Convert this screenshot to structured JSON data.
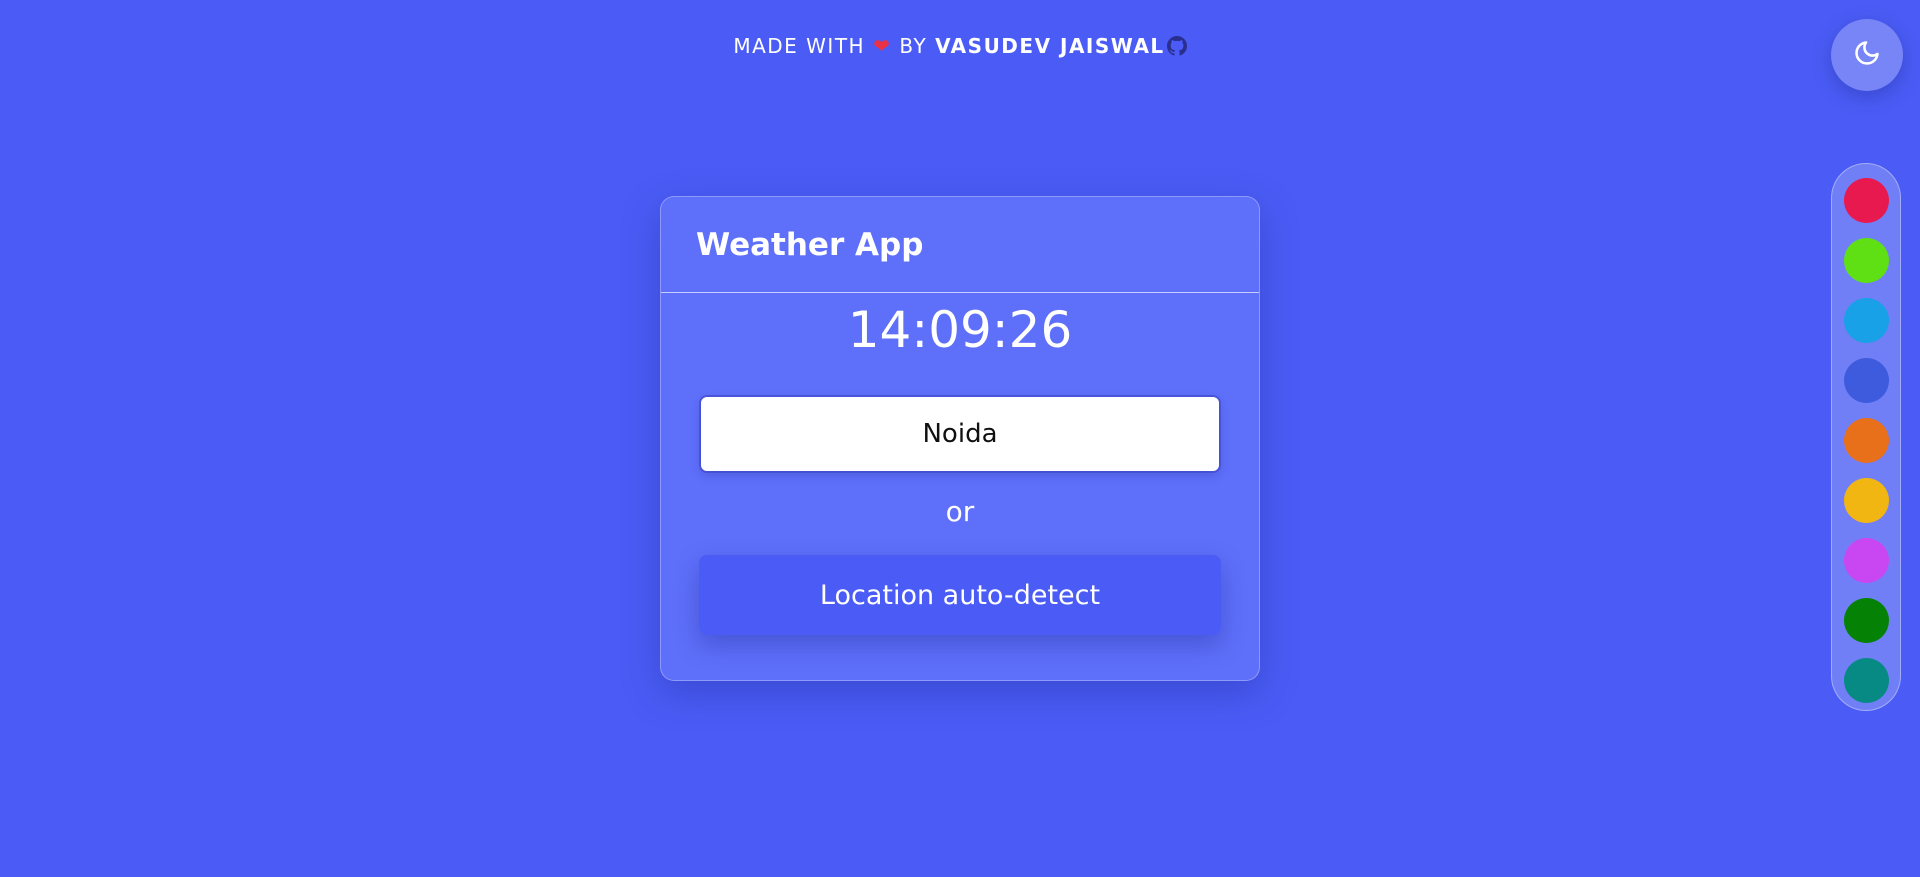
{
  "credit": {
    "prefix": "MADE WITH",
    "heart": "❤",
    "by": "BY",
    "author": "VASUDEV JAISWAL",
    "heart_icon": "heart-icon",
    "link_icon": "github-icon"
  },
  "theme_toggle": {
    "icon": "moon-icon"
  },
  "palette": {
    "swatches": [
      {
        "name": "crimson",
        "color": "#e8194f"
      },
      {
        "name": "lime",
        "color": "#5fe015"
      },
      {
        "name": "sky-blue",
        "color": "#18a1e6"
      },
      {
        "name": "royal-blue",
        "color": "#3d5bdc"
      },
      {
        "name": "orange",
        "color": "#e8701a"
      },
      {
        "name": "amber",
        "color": "#f2b612"
      },
      {
        "name": "violet",
        "color": "#c947f2"
      },
      {
        "name": "green",
        "color": "#058205"
      },
      {
        "name": "teal",
        "color": "#078a84"
      }
    ]
  },
  "card": {
    "title": "Weather App",
    "time": "14:09:26",
    "city_input": {
      "value": "Noida",
      "placeholder": ""
    },
    "or_label": "or",
    "detect_button_label": "Location auto-detect"
  },
  "colors": {
    "background": "#4a5cf5",
    "heart": "#e8324a"
  }
}
